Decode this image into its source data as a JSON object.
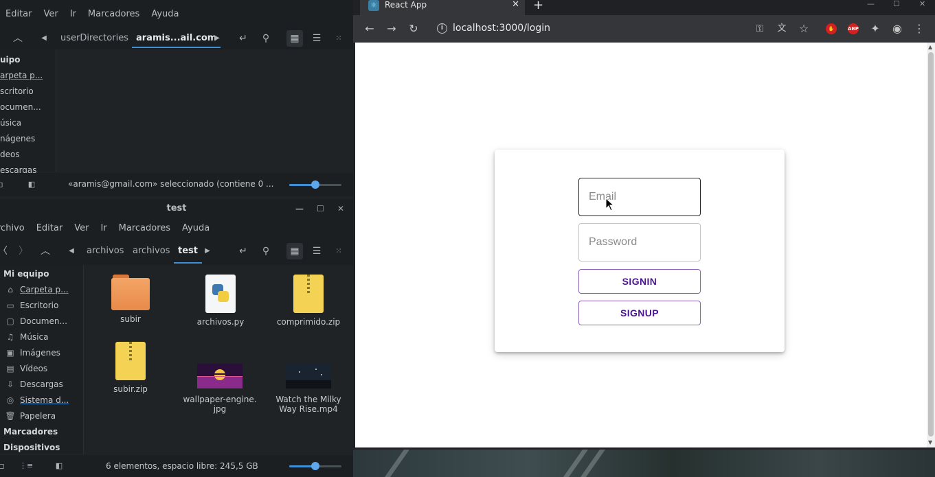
{
  "fm_top": {
    "menu": [
      "Editar",
      "Ver",
      "Ir",
      "Marcadores",
      "Ayuda"
    ],
    "breadcrumb": [
      "userDirectories",
      "aramis...ail.com"
    ],
    "sidebar": [
      "uipo",
      "arpeta p...",
      "scritorio",
      "ocumen...",
      "úsica",
      "nágenes",
      "deos",
      "escargas"
    ],
    "status": "«aramis@gmail.com» seleccionado (contiene 0 ...",
    "zoom_fraction": 0.5
  },
  "fm_bottom": {
    "title": "test",
    "menu": [
      "rchivo",
      "Editar",
      "Ver",
      "Ir",
      "Marcadores",
      "Ayuda"
    ],
    "breadcrumb": [
      "archivos",
      "archivos",
      "test"
    ],
    "sidebar_header": "Mi equipo",
    "sidebar": [
      {
        "label": "Carpeta p...",
        "icon": "home-icon"
      },
      {
        "label": "Escritorio",
        "icon": "desktop-icon"
      },
      {
        "label": "Documen...",
        "icon": "folder-icon"
      },
      {
        "label": "Música",
        "icon": "music-icon"
      },
      {
        "label": "Imágenes",
        "icon": "image-icon"
      },
      {
        "label": "Vídeos",
        "icon": "video-icon"
      },
      {
        "label": "Descargas",
        "icon": "download-icon"
      },
      {
        "label": "Sistema d...",
        "icon": "disk-icon"
      },
      {
        "label": "Papelera",
        "icon": "trash-icon"
      }
    ],
    "sidebar_bookmarks": "Marcadores",
    "sidebar_devices": "Dispositivos",
    "files": [
      {
        "name": "subir",
        "type": "folder"
      },
      {
        "name": "archivos.py",
        "type": "python"
      },
      {
        "name": "comprimido.zip",
        "type": "zip"
      },
      {
        "name": "subir.zip",
        "type": "zip"
      },
      {
        "name": "wallpaper-engine.\njpg",
        "type": "image"
      },
      {
        "name": "Watch the Milky\nWay Rise.mp4",
        "type": "video"
      }
    ],
    "status": "6 elementos, espacio libre: 245,5 GB",
    "zoom_fraction": 0.5
  },
  "browser": {
    "tab_title": "React App",
    "url": "localhost:3000/login",
    "login": {
      "email_placeholder": "Email",
      "password_placeholder": "Password",
      "signin_label": "SIGNIN",
      "signup_label": "SIGNUP"
    },
    "accent": "#4b1690",
    "adblock_label": "ABP"
  }
}
